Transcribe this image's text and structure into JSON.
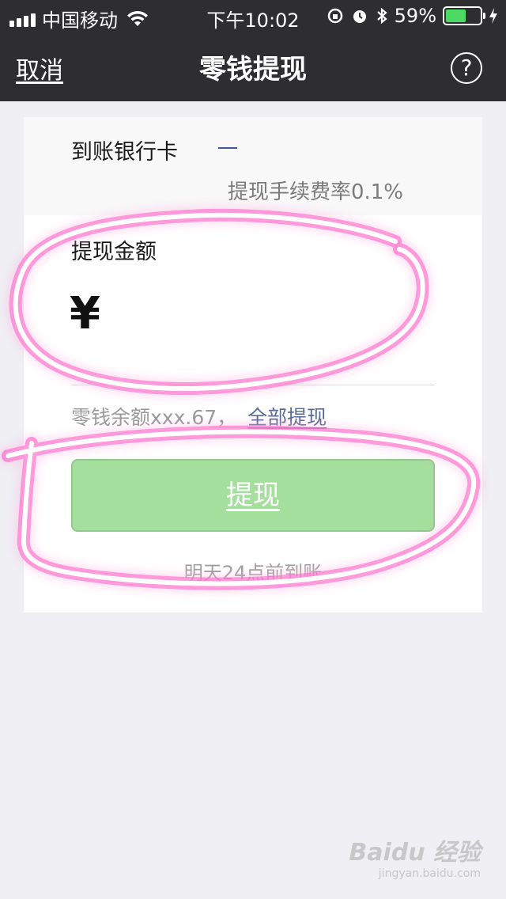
{
  "status_bar": {
    "carrier": "中国移动",
    "time": "下午10:02",
    "battery_percent": "59%",
    "battery_level": 0.59,
    "battery_color": "#4cd964"
  },
  "nav": {
    "cancel_label": "取消",
    "title": "零钱提现",
    "help_label": "?"
  },
  "form": {
    "bank_label": "到账银行卡",
    "fee_text": "提现手续费率0.1%",
    "amount_label": "提现金额",
    "currency_symbol": "¥",
    "balance_text": "零钱余额xxx.67，",
    "withdraw_all_label": "全部提现",
    "submit_label": "提现",
    "arrival_note": "明天24点前到账"
  },
  "colors": {
    "nav_bg": "#2e2e30",
    "button_bg": "#a5df9e",
    "link": "#576b95",
    "annotation": "#ff3fc4"
  },
  "watermark": {
    "brand": "Baidu 经验",
    "url": "jingyan.baidu.com"
  }
}
